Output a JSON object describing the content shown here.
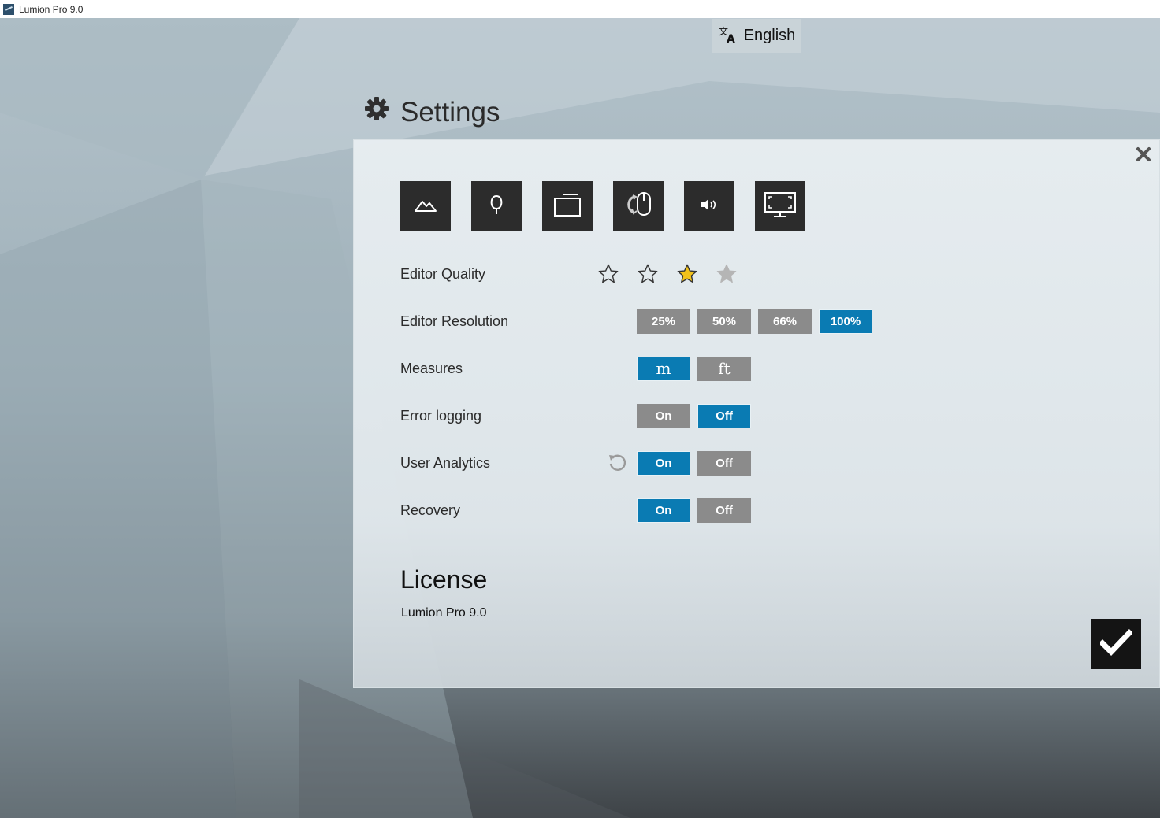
{
  "window": {
    "title": "Lumion Pro 9.0"
  },
  "language": {
    "label": "English",
    "icon": "translate-icon"
  },
  "settings": {
    "title": "Settings",
    "icon": "gear-icon"
  },
  "tabs": [
    {
      "name": "landscape-icon"
    },
    {
      "name": "tree-icon"
    },
    {
      "name": "window-icon"
    },
    {
      "name": "mouse-icon"
    },
    {
      "name": "sound-icon"
    },
    {
      "name": "monitor-icon"
    }
  ],
  "rows": {
    "editor_quality": {
      "label": "Editor Quality",
      "stars_total": 4,
      "selected": 3
    },
    "editor_resolution": {
      "label": "Editor Resolution",
      "options": [
        "25%",
        "50%",
        "66%",
        "100%"
      ],
      "selected": "100%"
    },
    "measures": {
      "label": "Measures",
      "options": [
        "m",
        "ft"
      ],
      "selected": "m"
    },
    "error_logging": {
      "label": "Error logging",
      "options": [
        "On",
        "Off"
      ],
      "selected": "Off"
    },
    "user_analytics": {
      "label": "User Analytics",
      "options": [
        "On",
        "Off"
      ],
      "selected": "On"
    },
    "recovery": {
      "label": "Recovery",
      "options": [
        "On",
        "Off"
      ],
      "selected": "On"
    }
  },
  "license": {
    "title": "License",
    "value": "Lumion Pro 9.0"
  },
  "colors": {
    "accent": "#0a7bb3",
    "inactive": "#8b8b8b",
    "tab_bg": "#2c2c2c",
    "star": "#f2c21b"
  }
}
